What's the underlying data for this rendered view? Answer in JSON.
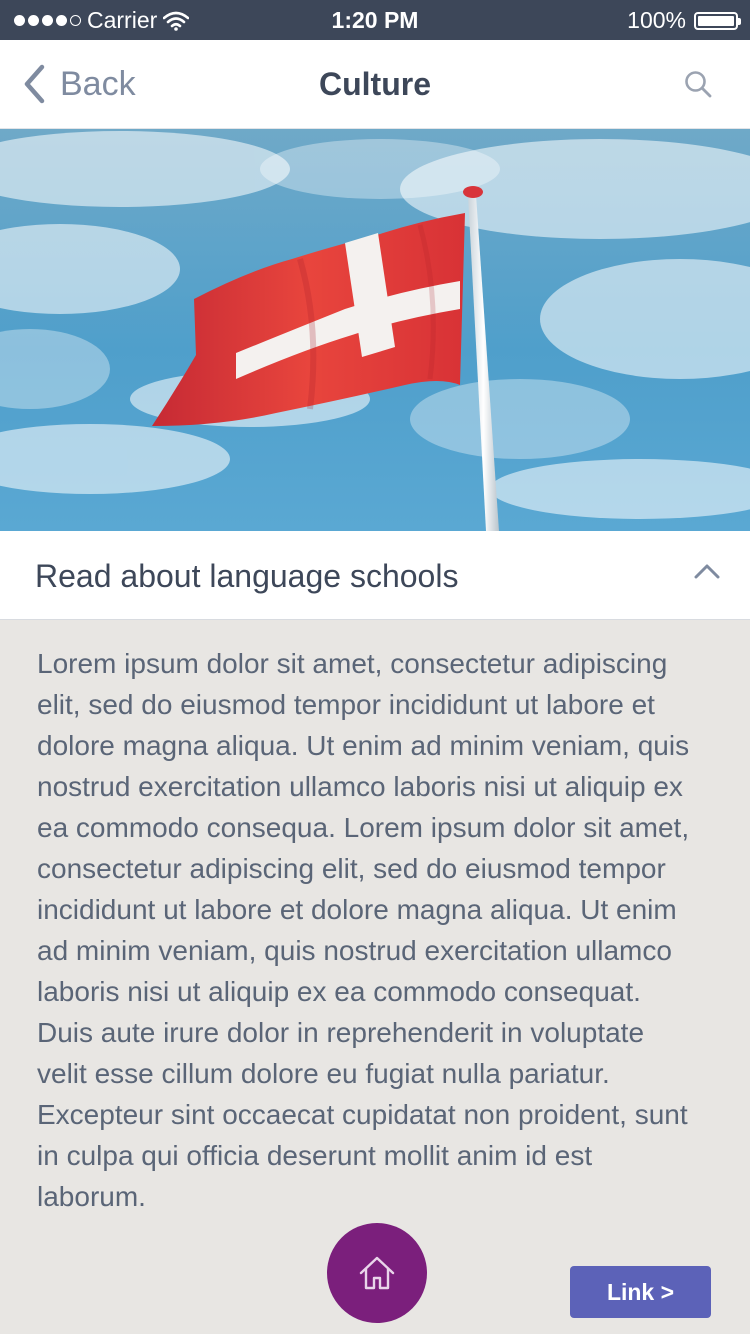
{
  "status": {
    "carrier": "Carrier",
    "time": "1:20 PM",
    "battery": "100%"
  },
  "nav": {
    "back_label": "Back",
    "title": "Culture"
  },
  "accordion": {
    "title": "Read about language schools"
  },
  "body_text": "Lorem ipsum dolor sit amet, consectetur adipiscing elit, sed do eiusmod tempor incididunt ut labore et dolore magna aliqua. Ut enim ad minim veniam, quis nostrud exercitation ullamco laboris nisi ut aliquip ex ea commodo consequa. Lorem ipsum dolor sit amet, consectetur adipiscing elit, sed do eiusmod tempor incididunt ut labore et dolore magna aliqua. Ut enim ad minim veniam, quis nostrud exercitation ullamco laboris nisi ut aliquip ex ea commodo consequat. Duis aute irure dolor in reprehenderit in voluptate velit esse cillum dolore eu fugiat nulla pariatur. Excepteur sint occaecat cupidatat non proident, sunt in culpa qui officia deserunt mollit anim id est laborum.",
  "link_button": {
    "label": "Link >"
  },
  "icons": {
    "back": "chevron-left-icon",
    "search": "search-icon",
    "collapse": "chevron-up-icon",
    "home": "home-icon"
  },
  "colors": {
    "status_bar": "#3d4759",
    "home_button": "#7b1f7c",
    "link_button": "#5c62b8",
    "background": "#e8e6e3"
  }
}
